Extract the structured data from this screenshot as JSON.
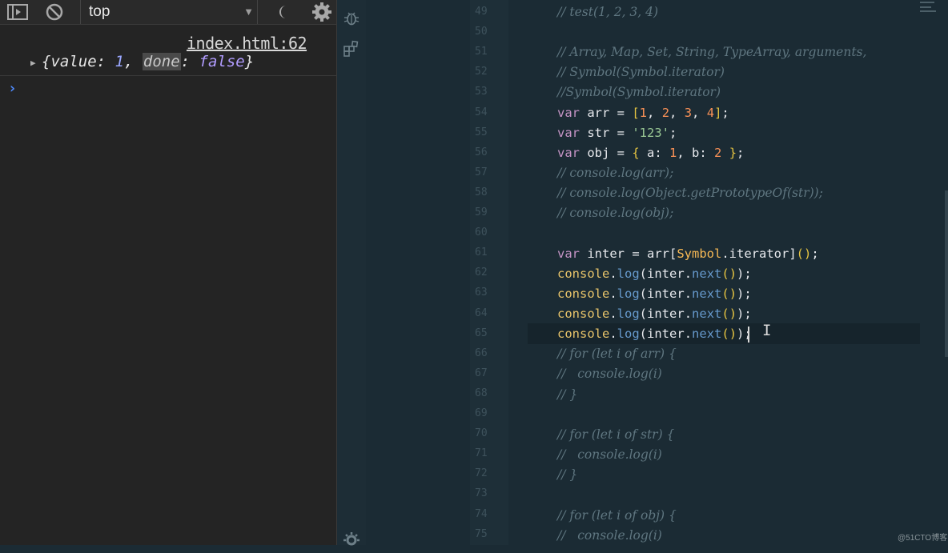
{
  "devtools": {
    "context": "top",
    "log": {
      "source": "index.html:62",
      "entry": {
        "open_brace": "{",
        "key1": "value",
        "colon1": ": ",
        "val1": "1",
        "comma": ", ",
        "key2": "done",
        "colon2": ": ",
        "val2": "false",
        "close_brace": "}"
      }
    },
    "prompt": "›"
  },
  "editor": {
    "line_numbers": [
      "49",
      "50",
      "51",
      "52",
      "53",
      "54",
      "55",
      "56",
      "57",
      "58",
      "59",
      "60",
      "61",
      "62",
      "63",
      "64",
      "65",
      "66",
      "67",
      "68",
      "69",
      "70",
      "71",
      "72",
      "73",
      "74",
      "75"
    ],
    "lines": {
      "l49": "// test(1, 2, 3, 4)",
      "l51": "// Array, Map, Set, String, TypeArray, arguments,",
      "l52": "// Symbol(Symbol.iterator)",
      "l53": "//Symbol(Symbol.iterator)",
      "l54": {
        "kw": "var",
        "rest1": " arr = ",
        "b1": "[",
        "n1": "1",
        "c1": ", ",
        "n2": "2",
        "c2": ", ",
        "n3": "3",
        "c3": ", ",
        "n4": "4",
        "b2": "]",
        "end": ";"
      },
      "l55": {
        "kw": "var",
        "rest1": " str = ",
        "s": "'123'",
        "end": ";"
      },
      "l56": {
        "kw": "var",
        "rest1": " obj = ",
        "b1": "{",
        "mid1": " a: ",
        "n1": "1",
        "mid2": ", b: ",
        "n2": "2",
        "sp": " ",
        "b2": "}",
        "end": ";"
      },
      "l57": "// console.log(arr);",
      "l58": "// console.log(Object.getPrototypeOf(str));",
      "l59": "// console.log(obj);",
      "l61": {
        "kw": "var",
        "rest1": " inter = arr",
        "b1": "[",
        "cls": "Symbol",
        "dot": ".",
        "prop": "iterator",
        "b2": "]",
        "call": "()",
        "end": ";"
      },
      "log_call": {
        "obj": "console",
        "dot": ".",
        "fn": "log",
        "open": "(",
        "arg": "inter",
        "dot2": ".",
        "fn2": "next",
        "call": "()",
        "close": ")",
        "end": ";"
      },
      "l66": "// for (let i of arr) {",
      "l67": "//   console.log(i)",
      "l68": "// }",
      "l70": "// for (let i of str) {",
      "l71": "//   console.log(i)",
      "l72": "// }",
      "l74": "// for (let i of obj) {",
      "l75": "//   console.log(i)"
    },
    "ibeam": "I"
  },
  "watermark": "@51CTO博客",
  "colors": {
    "editor_bg": "#1b2b34",
    "console_bg": "#242424",
    "keyword": "#c594c5",
    "number": "#f99157",
    "string": "#99c794",
    "function": "#6699cc",
    "comment": "#5f7680"
  },
  "icons": [
    "dock-panel-icon",
    "clear-console-icon",
    "dropdown-arrow-icon",
    "eye-icon",
    "gear-icon",
    "debug-icon",
    "extensions-icon",
    "settings-icon"
  ]
}
